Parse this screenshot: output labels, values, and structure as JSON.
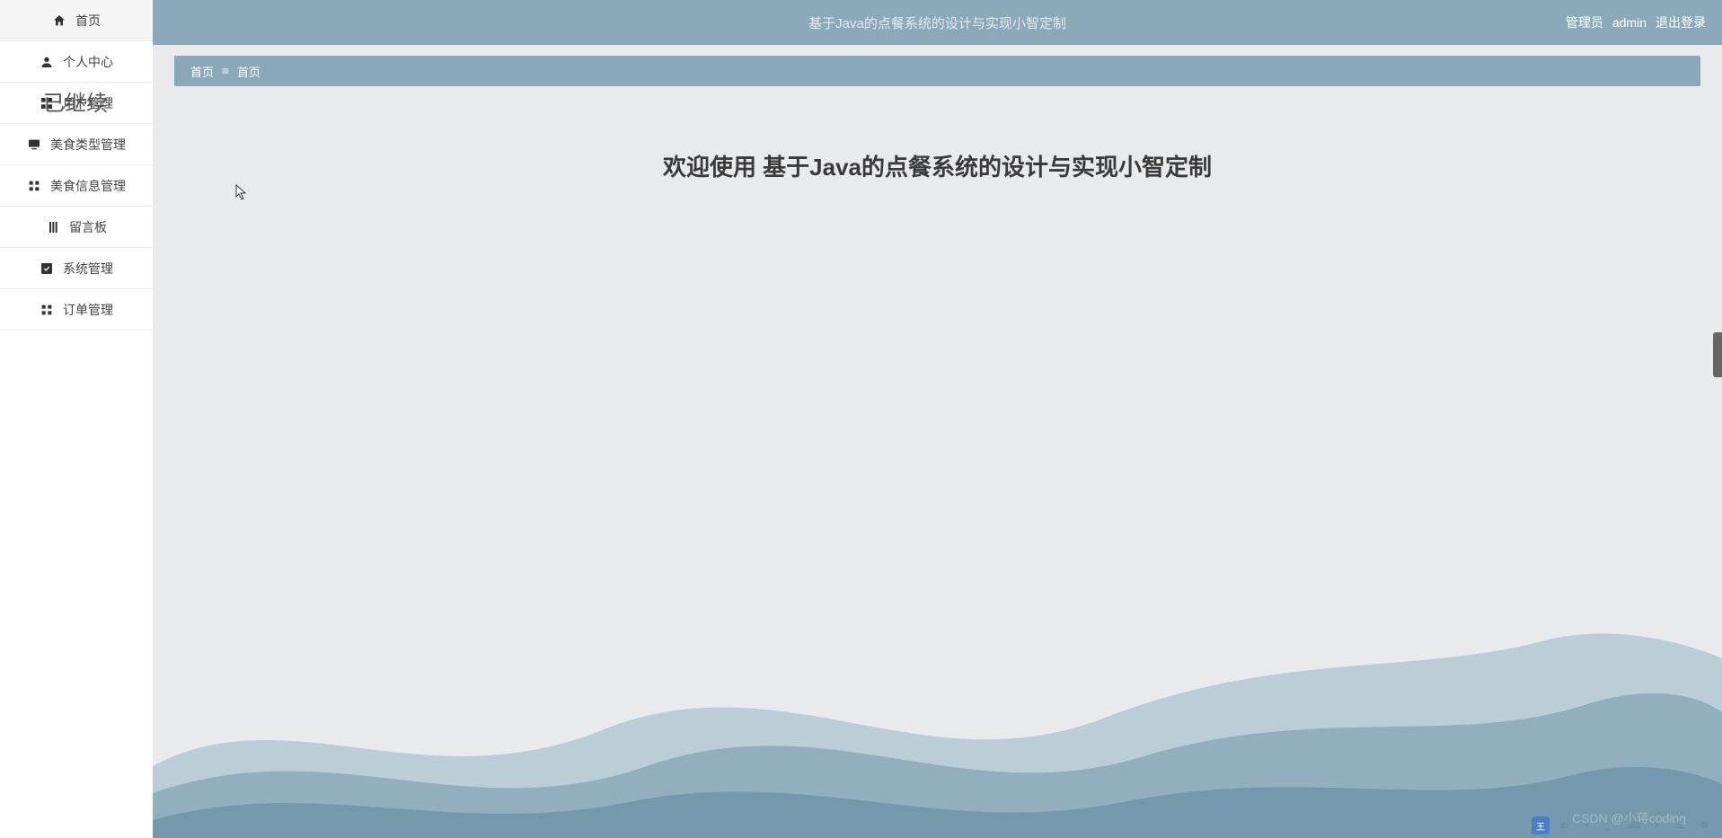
{
  "header": {
    "title": "基于Java的点餐系统的设计与实现小智定制",
    "role_label": "管理员",
    "username": "admin",
    "logout_label": "退出登录"
  },
  "sidebar": {
    "items": [
      {
        "label": "首页",
        "icon": "home"
      },
      {
        "label": "个人中心",
        "icon": "person"
      },
      {
        "label": "用户管理",
        "icon": "grid"
      },
      {
        "label": "美食类型管理",
        "icon": "monitor"
      },
      {
        "label": "美食信息管理",
        "icon": "apps"
      },
      {
        "label": "留言板",
        "icon": "bookmark"
      },
      {
        "label": "系统管理",
        "icon": "check"
      },
      {
        "label": "订单管理",
        "icon": "grid2"
      }
    ]
  },
  "breadcrumb": {
    "root": "首页",
    "current": "首页"
  },
  "main": {
    "welcome_text": "欢迎使用 基于Java的点餐系统的设计与实现小智定制"
  },
  "overlay": {
    "watermark_text": "已继续",
    "footer_watermark": "CSDN @小蒋coding"
  }
}
